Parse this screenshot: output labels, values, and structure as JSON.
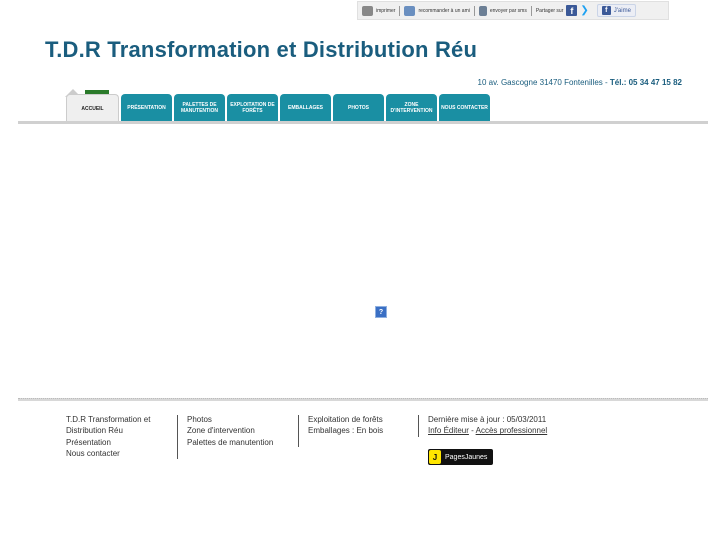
{
  "toolbar": {
    "print": "imprimer",
    "recommend": "recommander à un ami",
    "email": "envoyer par sms",
    "share": "Partager sur",
    "like": "J'aime"
  },
  "header": {
    "title": "T.D.R Transformation et Distribution Réu",
    "address": "10 av. Gascogne 31470 Fontenilles",
    "tel_label": "Tél.:",
    "tel": "05 34 47 15 82"
  },
  "nav": [
    {
      "label": "ACCUEIL",
      "active": true
    },
    {
      "label": "PRÉSENTATION"
    },
    {
      "label": "PALETTES DE MANUTENTION"
    },
    {
      "label": "EXPLOITATION DE FORÊTS"
    },
    {
      "label": "EMBALLAGES"
    },
    {
      "label": "PHOTOS"
    },
    {
      "label": "ZONE D'INTERVENTION"
    },
    {
      "label": "NOUS CONTACTER"
    }
  ],
  "content": {
    "broken_image": "?"
  },
  "footer": {
    "col1": [
      "T.D.R Transformation et",
      "Distribution Réu",
      "Présentation",
      "Nous contacter"
    ],
    "col2": [
      "Photos",
      "Zone d'intervention",
      "Palettes de manutention"
    ],
    "col3": [
      "Exploitation de forêts",
      "Emballages : En bois"
    ],
    "updated": "Dernière mise à jour : 05/03/2011",
    "info_editeur": "Info Éditeur",
    "sep": "-",
    "acces_pro": "Accès professionnel",
    "pages_jaunes": "PagesJaunes",
    "pj_badge": "J"
  },
  "colors": {
    "brand": "#1a5d7e",
    "tab": "#1a8fa3"
  }
}
